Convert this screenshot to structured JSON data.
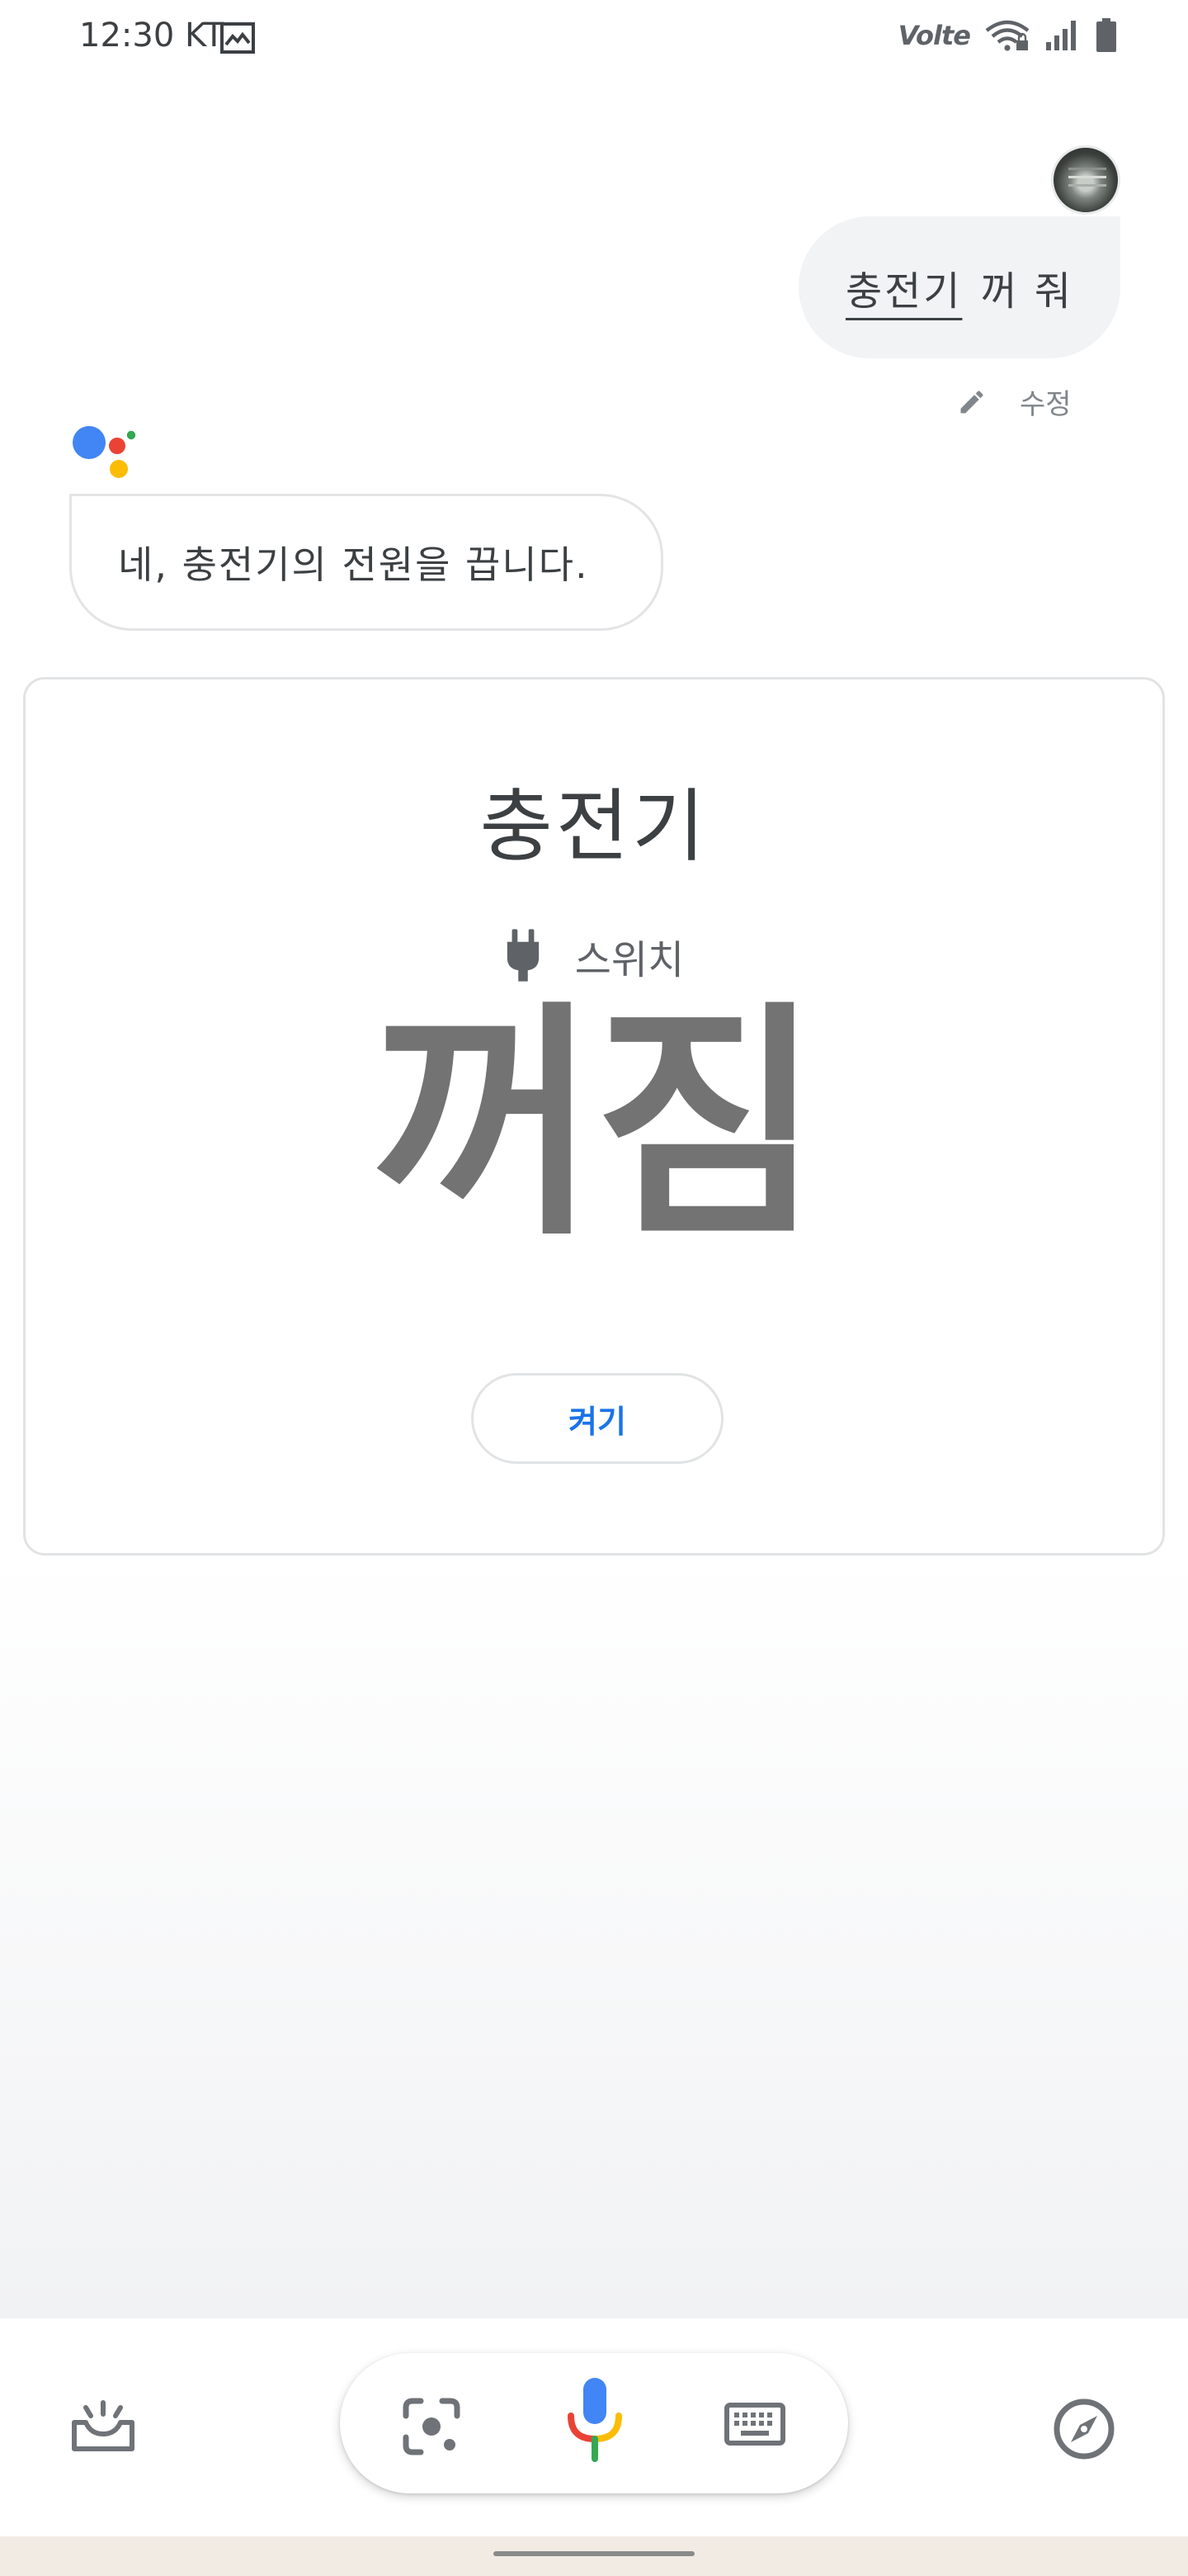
{
  "status_bar": {
    "time": "12:30",
    "carrier": "KT",
    "gallery_icon": "image-icon",
    "network_label": "Volte",
    "icons": [
      "volte-icon",
      "wifi-icon",
      "signal-icon",
      "battery-icon"
    ]
  },
  "conversation": {
    "user_query": {
      "word_underlined": "충전기",
      "rest": "꺼 줘"
    },
    "edit_label": "수정",
    "assistant_reply": "네, 충전기의 전원을 끕니다."
  },
  "device_card": {
    "device_name": "충전기",
    "device_type_icon": "plug-icon",
    "device_type": "스위치",
    "state": "꺼짐",
    "action_button": "켜기"
  },
  "bottom_bar": {
    "icons": [
      "updates-tray-icon",
      "lens-icon",
      "mic-icon",
      "keyboard-icon",
      "explore-compass-icon"
    ]
  },
  "colors": {
    "accent_blue": "#1a73e8",
    "google_blue": "#4285f4",
    "google_red": "#ea4335",
    "google_yellow": "#fbbc04",
    "google_green": "#34a853"
  }
}
